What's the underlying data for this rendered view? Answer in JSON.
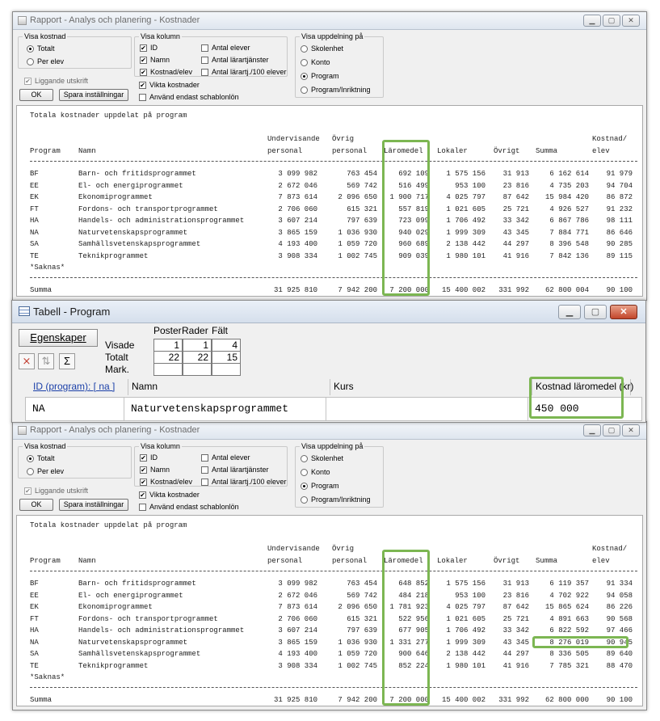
{
  "report_window": {
    "title": "Rapport - Analys och planering - Kostnader",
    "visa_kostnad": {
      "legend": "Visa kostnad",
      "options": [
        "Totalt",
        "Per elev"
      ],
      "selected": "Totalt"
    },
    "visa_kolumn": {
      "legend": "Visa kolumn",
      "left": [
        {
          "label": "ID",
          "checked": true
        },
        {
          "label": "Namn",
          "checked": true
        },
        {
          "label": "Kostnad/elev",
          "checked": true
        }
      ],
      "right": [
        {
          "label": "Antal elever",
          "checked": false
        },
        {
          "label": "Antal lärartjänster",
          "checked": false
        },
        {
          "label": "Antal lärartj./100 elever",
          "checked": false
        }
      ],
      "extra": [
        {
          "label": "Vikta kostnader",
          "checked": true
        },
        {
          "label": "Använd endast schablonlön",
          "checked": false
        }
      ]
    },
    "visa_uppdelning": {
      "legend": "Visa uppdelning på",
      "options": [
        "Skolenhet",
        "Konto",
        "Program",
        "Program/Inriktning"
      ],
      "selected": "Program"
    },
    "liggande_utskrift": "Liggande utskrift",
    "ok_label": "OK",
    "save_label": "Spara inställningar"
  },
  "report": {
    "title": "Totala kostnader uppdelat på program",
    "header1": [
      "",
      "",
      "Undervisande",
      "Övrig",
      "",
      "",
      "",
      "",
      "Kostnad/"
    ],
    "header2": [
      "Program",
      "Namn",
      "personal",
      "personal",
      "Läromedel",
      "Lokaler",
      "Övrigt",
      "Summa",
      "elev"
    ],
    "missing_label": "*Saknas*",
    "sum_label": "Summa"
  },
  "report_before": {
    "rows": [
      [
        "BF",
        "Barn- och fritidsprogrammet",
        "3 099 982",
        "763 454",
        "692 109",
        "1 575 156",
        "31 913",
        "6 162 614",
        "91 979"
      ],
      [
        "EE",
        "El- och energiprogrammet",
        "2 672 046",
        "569 742",
        "516 499",
        "953 100",
        "23 816",
        "4 735 203",
        "94 704"
      ],
      [
        "EK",
        "Ekonomiprogrammet",
        "7 873 614",
        "2 096 650",
        "1 900 717",
        "4 025 797",
        "87 642",
        "15 984 420",
        "86 872"
      ],
      [
        "FT",
        "Fordons- och transportprogrammet",
        "2 706 060",
        "615 321",
        "557 819",
        "1 021 605",
        "25 721",
        "4 926 527",
        "91 232"
      ],
      [
        "HA",
        "Handels- och administrationsprogrammet",
        "3 607 214",
        "797 639",
        "723 099",
        "1 706 492",
        "33 342",
        "6 867 786",
        "98 111"
      ],
      [
        "NA",
        "Naturvetenskapsprogrammet",
        "3 865 159",
        "1 036 930",
        "940 029",
        "1 999 309",
        "43 345",
        "7 884 771",
        "86 646"
      ],
      [
        "SA",
        "Samhällsvetenskapsprogrammet",
        "4 193 400",
        "1 059 720",
        "960 689",
        "2 138 442",
        "44 297",
        "8 396 548",
        "90 285"
      ],
      [
        "TE",
        "Teknikprogrammet",
        "3 908 334",
        "1 002 745",
        "909 039",
        "1 980 101",
        "41 916",
        "7 842 136",
        "89 115"
      ]
    ],
    "sum": [
      "31 925 810",
      "7 942 200",
      "7 200 000",
      "15 400 002",
      "331 992",
      "62 800 004",
      "90 100"
    ]
  },
  "report_after": {
    "rows": [
      [
        "BF",
        "Barn- och fritidsprogrammet",
        "3 099 982",
        "763 454",
        "648 852",
        "1 575 156",
        "31 913",
        "6 119 357",
        "91 334"
      ],
      [
        "EE",
        "El- och energiprogrammet",
        "2 672 046",
        "569 742",
        "484 218",
        "953 100",
        "23 816",
        "4 702 922",
        "94 058"
      ],
      [
        "EK",
        "Ekonomiprogrammet",
        "7 873 614",
        "2 096 650",
        "1 781 923",
        "4 025 797",
        "87 642",
        "15 865 624",
        "86 226"
      ],
      [
        "FT",
        "Fordons- och transportprogrammet",
        "2 706 060",
        "615 321",
        "522 956",
        "1 021 605",
        "25 721",
        "4 891 663",
        "90 568"
      ],
      [
        "HA",
        "Handels- och administrationsprogrammet",
        "3 607 214",
        "797 639",
        "677 905",
        "1 706 492",
        "33 342",
        "6 822 592",
        "97 466"
      ],
      [
        "NA",
        "Naturvetenskapsprogrammet",
        "3 865 159",
        "1 036 930",
        "1 331 277",
        "1 999 309",
        "43 345",
        "8 276 019",
        "90 945"
      ],
      [
        "SA",
        "Samhällsvetenskapsprogrammet",
        "4 193 400",
        "1 059 720",
        "900 646",
        "2 138 442",
        "44 297",
        "8 336 505",
        "89 640"
      ],
      [
        "TE",
        "Teknikprogrammet",
        "3 908 334",
        "1 002 745",
        "852 224",
        "1 980 101",
        "41 916",
        "7 785 321",
        "88 470"
      ]
    ],
    "sum": [
      "31 925 810",
      "7 942 200",
      "7 200 000",
      "15 400 002",
      "331 992",
      "62 800 000",
      "90 100"
    ]
  },
  "table_window": {
    "title": "Tabell - Program",
    "egenskaper": "Egenskaper",
    "stats_headers": [
      "Poster",
      "Rader",
      "Fält"
    ],
    "stats_rows": [
      {
        "label": "Visade",
        "values": [
          "1",
          "1",
          "4"
        ]
      },
      {
        "label": "Totalt",
        "values": [
          "22",
          "22",
          "15"
        ]
      },
      {
        "label": "Mark.",
        "values": [
          "",
          "",
          ""
        ]
      }
    ],
    "columns": [
      "ID (program): [ na ]",
      "Namn",
      "Kurs",
      "Kostnad läromedel (kr)"
    ],
    "row": [
      "NA",
      "Naturvetenskapsprogrammet",
      "",
      "450 000"
    ],
    "highlight_color": "#7cb652"
  }
}
